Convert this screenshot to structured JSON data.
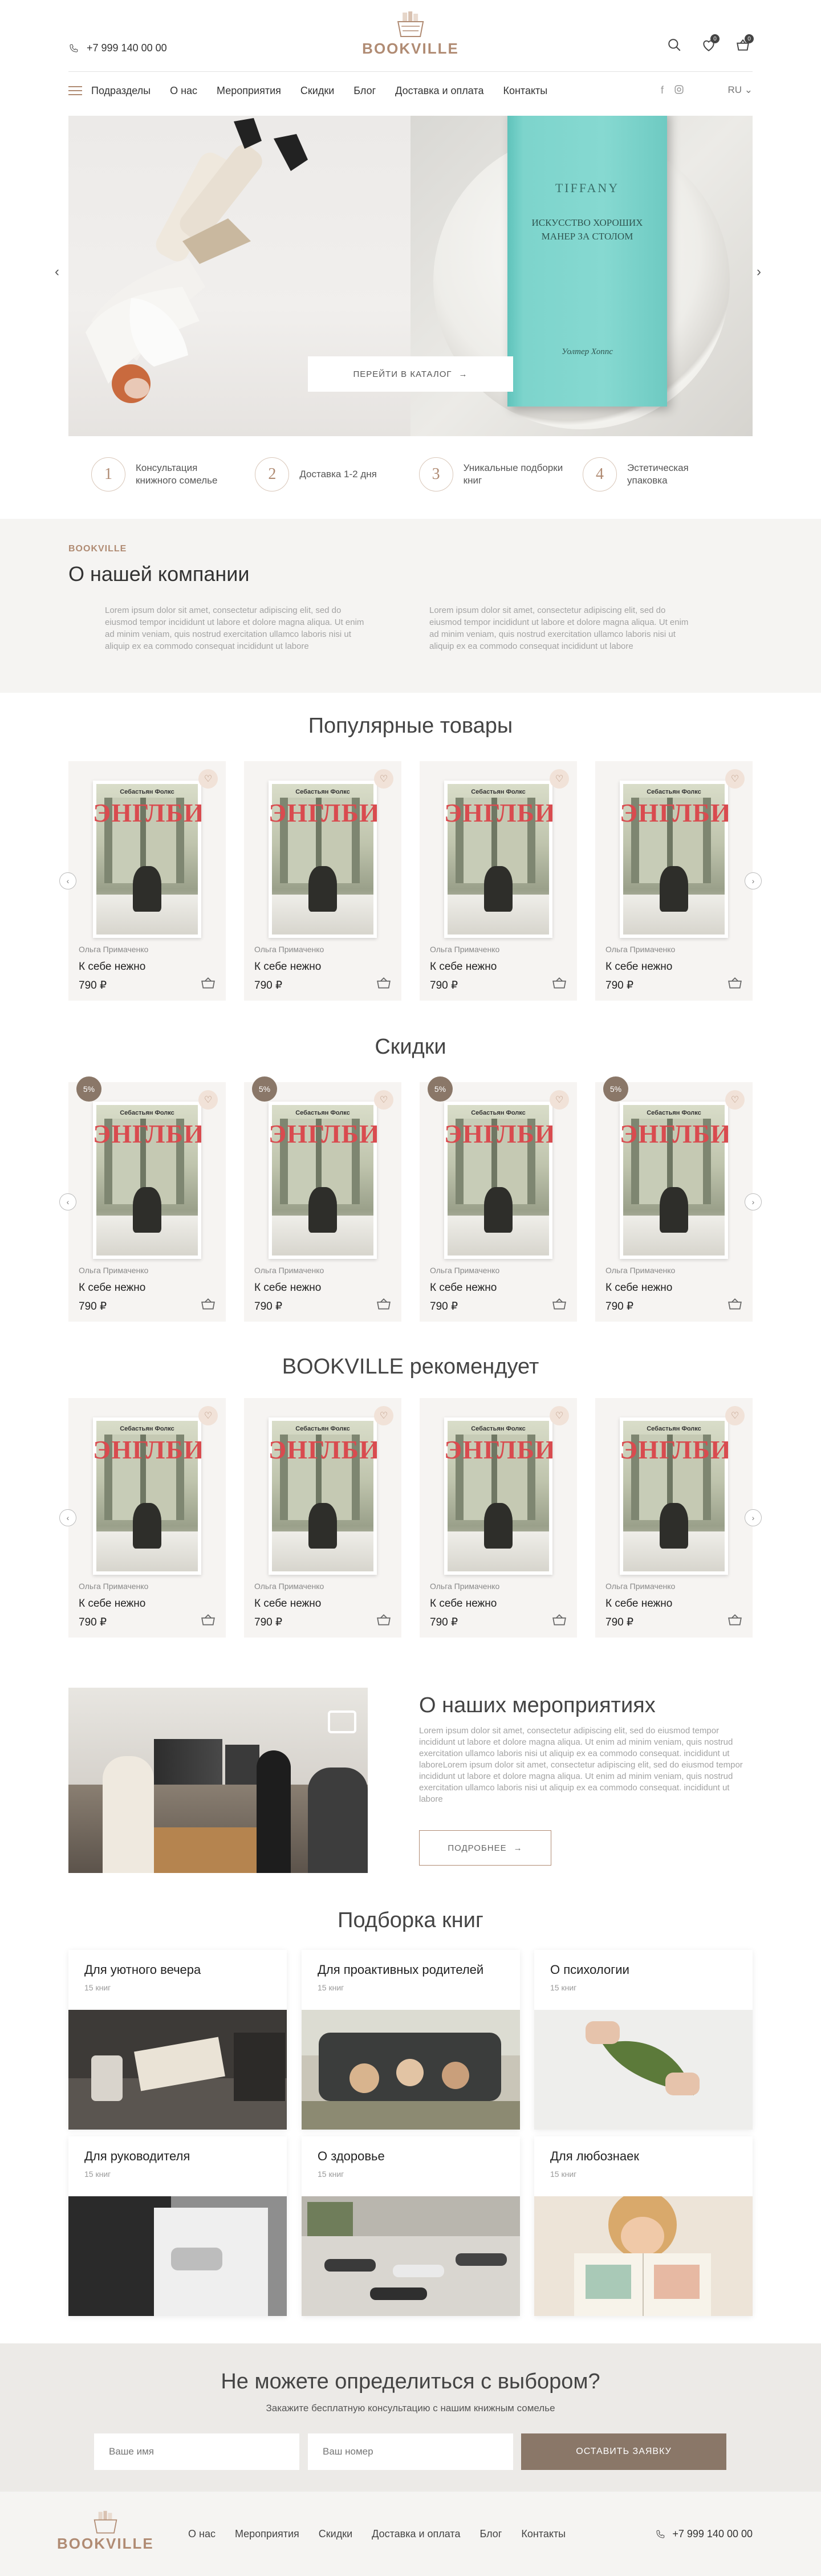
{
  "header": {
    "phone": "+7 999 140 00 00",
    "logo_text": "BOOKVILLE",
    "favorites_count": "0",
    "cart_count": "0"
  },
  "nav": {
    "items": [
      "Подразделы",
      "О нас",
      "Мероприятия",
      "Скидки",
      "Блог",
      "Доставка и оплата",
      "Контакты"
    ],
    "lang": "RU"
  },
  "hero": {
    "book_brand": "TIFFANY",
    "book_title": "ИСКУССТВО ХОРОШИХ МАНЕР ЗА СТОЛОМ",
    "book_author": "Уолтер Хоппс",
    "cta_label": "ПЕРЕЙТИ В КАТАЛОГ"
  },
  "features": [
    {
      "num": "1",
      "text": "Консультация книжного сомелье"
    },
    {
      "num": "2",
      "text": "Доставка 1-2 дня"
    },
    {
      "num": "3",
      "text": "Уникальные подборки книг"
    },
    {
      "num": "4",
      "text": "Эстетическая упаковка"
    }
  ],
  "about": {
    "kicker": "BOOKVILLE",
    "title": "О нашей компании",
    "text1": "Lorem ipsum dolor sit amet, consectetur adipiscing elit, sed do eiusmod tempor incididunt ut labore et dolore magna aliqua. Ut enim ad minim veniam, quis nostrud exercitation ullamco laboris nisi ut aliquip ex ea commodo consequat incididunt ut labore",
    "text2": "Lorem ipsum dolor sit amet, consectetur adipiscing elit, sed do eiusmod tempor incididunt ut labore et dolore magna aliqua. Ut enim ad minim veniam, quis nostrud exercitation ullamco laboris nisi ut aliquip ex ea commodo consequat incididunt ut labore"
  },
  "sections": {
    "popular": "Популярные товары",
    "discounts": "Скидки",
    "recommends": "BOOKVILLE рекомендует",
    "collections": "Подборка книг"
  },
  "product": {
    "cover_author": "Себастьян Фолкс",
    "cover_title": "ЭНГЛБИ",
    "author": "Ольга Примаченко",
    "title": "К себе нежно",
    "price": "790 ₽",
    "discount": "5%"
  },
  "events": {
    "title": "О наших мероприятиях",
    "text": "Lorem ipsum dolor sit amet, consectetur adipiscing elit, sed do eiusmod tempor incididunt ut labore et dolore magna aliqua. Ut enim ad minim veniam, quis nostrud exercitation ullamco laboris nisi ut aliquip ex ea commodo consequat. incididunt ut laboreLorem ipsum dolor sit amet, consectetur adipiscing elit, sed do eiusmod tempor incididunt ut labore et dolore magna aliqua. Ut enim ad minim veniam, quis nostrud exercitation ullamco laboris nisi ut aliquip ex ea commodo consequat. incididunt ut labore",
    "button": "ПОДРОБНЕЕ"
  },
  "collections": [
    {
      "title": "Для уютного вечера",
      "count": "15 книг"
    },
    {
      "title": "Для проактивных родителей",
      "count": "15 книг"
    },
    {
      "title": "О психологии",
      "count": "15 книг"
    },
    {
      "title": "Для руководителя",
      "count": "15 книг"
    },
    {
      "title": "О здоровье",
      "count": "15 книг"
    },
    {
      "title": "Для любознаек",
      "count": "15 книг"
    }
  ],
  "cta": {
    "title": "Не можете определиться с выбором?",
    "subtitle": "Закажите бесплатную консультацию с нашим книжным сомелье",
    "name_placeholder": "Ваше имя",
    "phone_placeholder": "Ваш номер",
    "submit": "ОСТАВИТЬ ЗАЯВКУ"
  },
  "footer": {
    "logo_text": "BOOKVILLE",
    "nav": [
      "О нас",
      "Мероприятия",
      "Скидки",
      "Доставка и оплата",
      "Блог",
      "Контакты"
    ],
    "phone": "+7 999 140 00 00"
  },
  "colors": {
    "accent": "#b08b73",
    "button_dark": "#8a7768",
    "section_bg": "#f5f4f2"
  }
}
